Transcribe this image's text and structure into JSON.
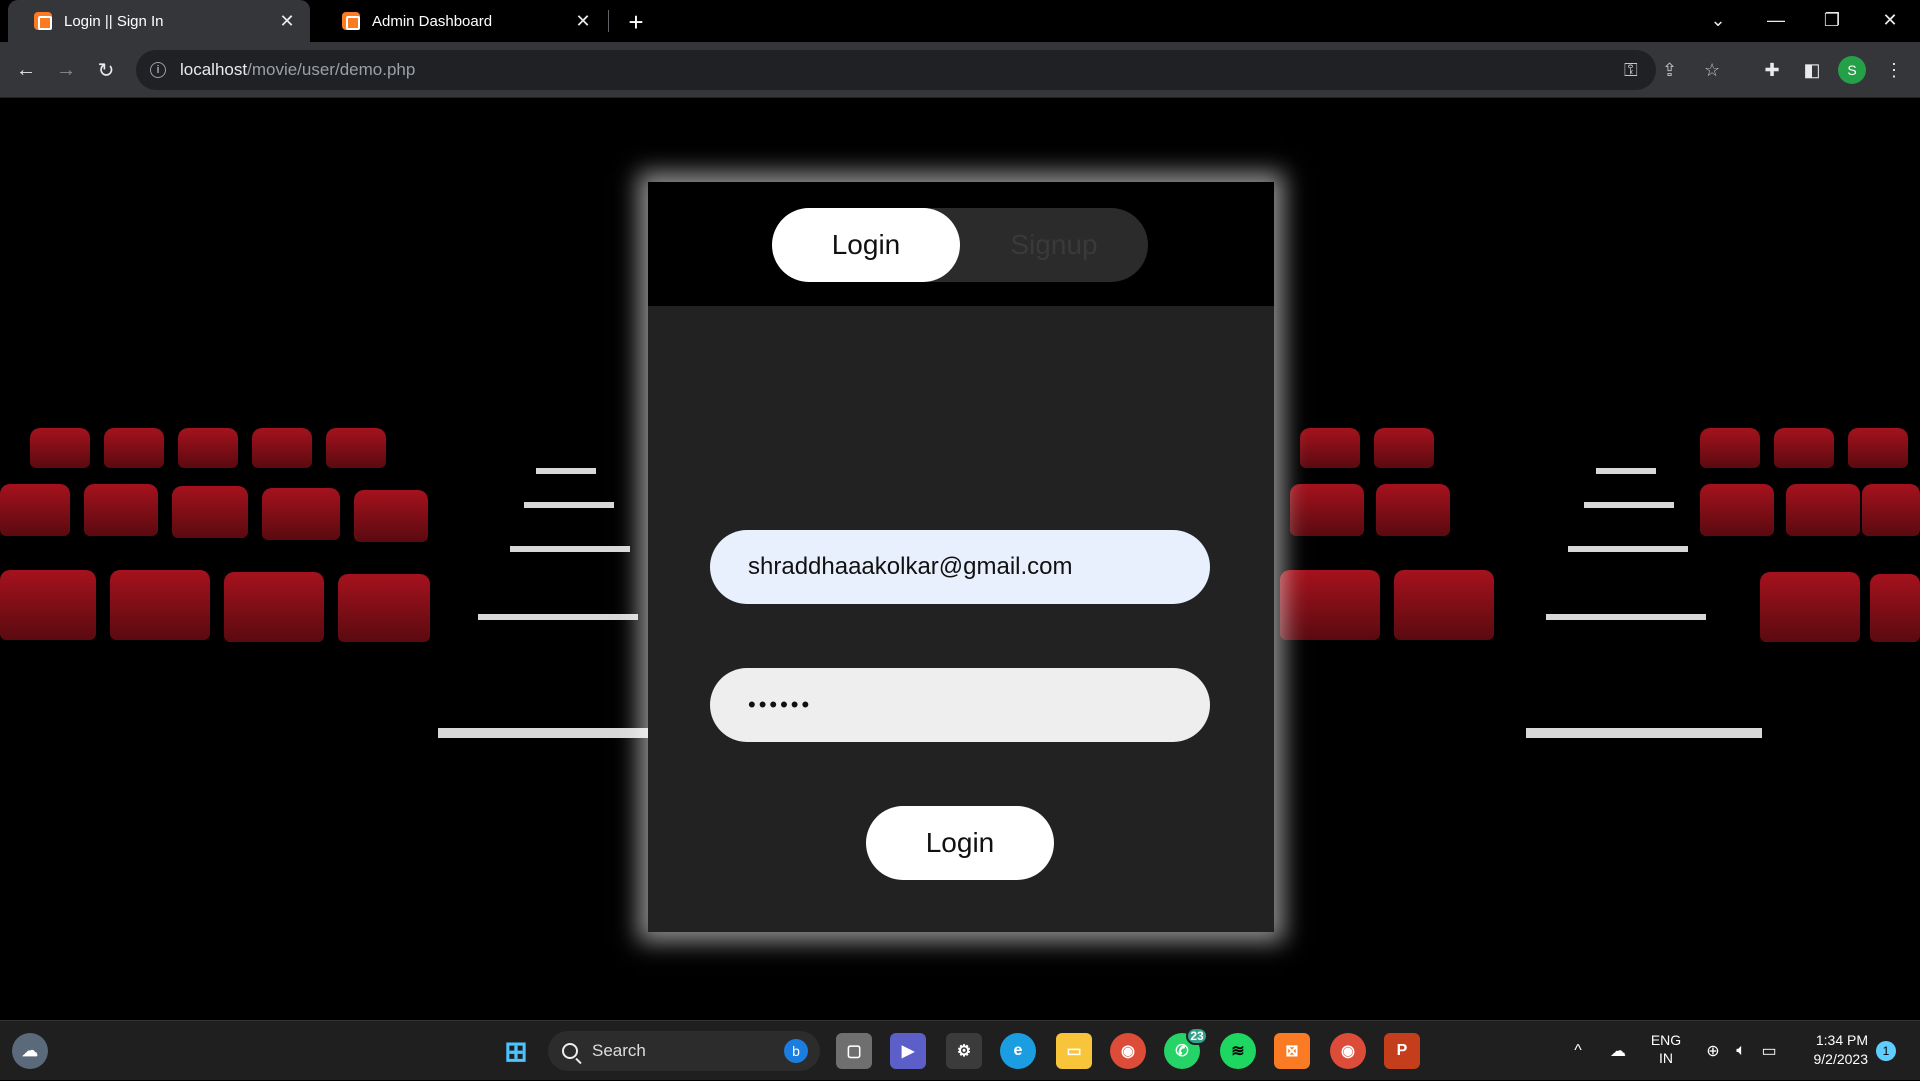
{
  "browser": {
    "tabs": [
      {
        "title": "Login || Sign In",
        "active": true
      },
      {
        "title": "Admin Dashboard",
        "active": false
      }
    ],
    "address": {
      "host": "localhost",
      "path": "/movie/user/demo.php"
    },
    "profile_initial": "S"
  },
  "login_panel": {
    "toggle": {
      "login_label": "Login",
      "signup_label": "Signup",
      "selected": "Login"
    },
    "email_value": "shraddhaaakolkar@gmail.com",
    "password_value": "••••••",
    "submit_label": "Login"
  },
  "colors": {
    "panel_bg": "#232223",
    "email_field_bg": "#e8f0fe",
    "seat_red": "#a5121d"
  },
  "taskbar": {
    "search_label": "Search",
    "whatsapp_badge": "23",
    "language": {
      "line1": "ENG",
      "line2": "IN"
    },
    "time": "1:34 PM",
    "date": "9/2/2023",
    "notification_count": "1"
  }
}
